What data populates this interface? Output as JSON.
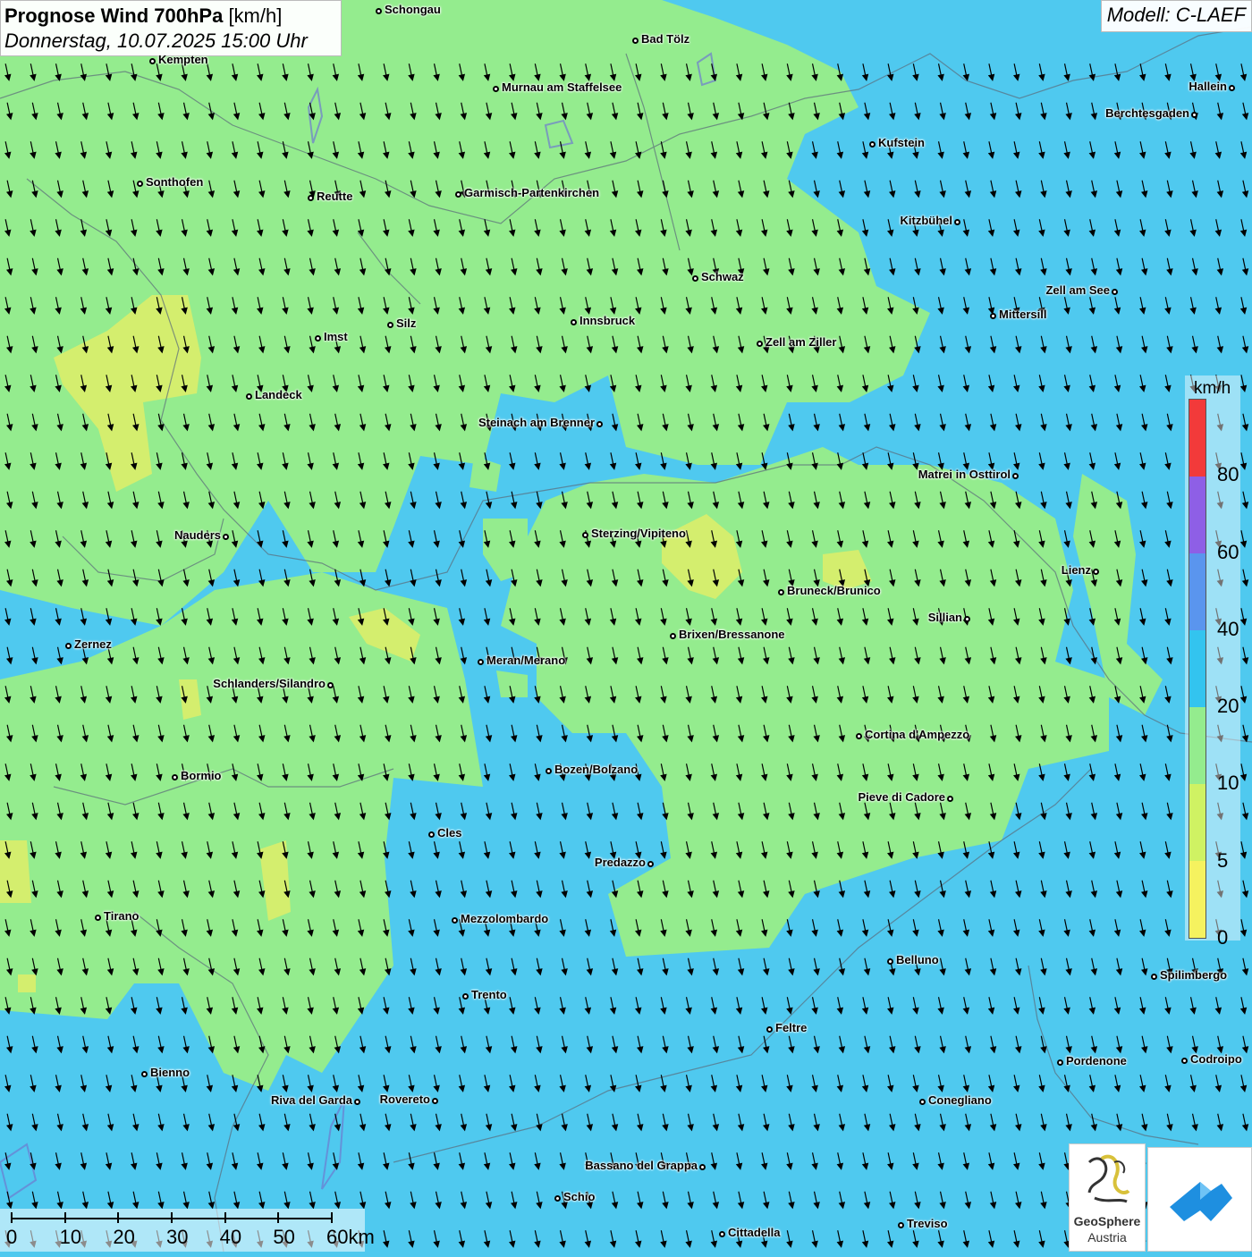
{
  "header": {
    "title_bold": "Prognose Wind 700hPa",
    "title_unit": "[km/h]",
    "datetime": "Donnerstag, 10.07.2025 15:00 Uhr"
  },
  "model_label": "Modell: C-LAEF",
  "legend": {
    "unit": "km/h",
    "ticks": [
      "80",
      "60",
      "40",
      "20",
      "10",
      "5",
      "0"
    ],
    "colors": [
      "#f23a3a",
      "#8e5fe6",
      "#5a95ee",
      "#33c4ef",
      "#94ec8e",
      "#cff263",
      "#f5f25f"
    ]
  },
  "scalebar": {
    "labels": [
      "0",
      "10",
      "20",
      "30",
      "40",
      "50",
      "60km"
    ]
  },
  "logo": {
    "name": "GeoSphere",
    "sub": "Austria"
  },
  "wind_direction": "north-northwest",
  "cities": [
    {
      "name": "Schongau"
    },
    {
      "name": "Bad Tölz"
    },
    {
      "name": "Kempten"
    },
    {
      "name": "Murnau am Staffelsee"
    },
    {
      "name": "Hallein"
    },
    {
      "name": "Berchtesgaden"
    },
    {
      "name": "Kufstein"
    },
    {
      "name": "Sonthofen"
    },
    {
      "name": "Reutte"
    },
    {
      "name": "Garmisch-Partenkirchen"
    },
    {
      "name": "Kitzbühel"
    },
    {
      "name": "Schwaz"
    },
    {
      "name": "Zell am See"
    },
    {
      "name": "Mittersill"
    },
    {
      "name": "Innsbruck"
    },
    {
      "name": "Silz"
    },
    {
      "name": "Imst"
    },
    {
      "name": "Zell am Ziller"
    },
    {
      "name": "Landeck"
    },
    {
      "name": "Steinach am Brenner"
    },
    {
      "name": "Matrei in Osttirol"
    },
    {
      "name": "Nauders"
    },
    {
      "name": "Sterzing/Vipiteno"
    },
    {
      "name": "Lienz"
    },
    {
      "name": "Bruneck/Brunico"
    },
    {
      "name": "Sillian"
    },
    {
      "name": "Brixen/Bressanone"
    },
    {
      "name": "Zernez"
    },
    {
      "name": "Meran/Merano"
    },
    {
      "name": "Schlanders/Silandro"
    },
    {
      "name": "Cortina d'Ampezzo"
    },
    {
      "name": "Bozen/Bolzano"
    },
    {
      "name": "Bormio"
    },
    {
      "name": "Pieve di Cadore"
    },
    {
      "name": "Cles"
    },
    {
      "name": "Predazzo"
    },
    {
      "name": "Tirano"
    },
    {
      "name": "Mezzolombardo"
    },
    {
      "name": "Belluno"
    },
    {
      "name": "Spilimbergo"
    },
    {
      "name": "Trento"
    },
    {
      "name": "Feltre"
    },
    {
      "name": "Pordenone"
    },
    {
      "name": "Codroipo"
    },
    {
      "name": "Bienno"
    },
    {
      "name": "Riva del Garda"
    },
    {
      "name": "Rovereto"
    },
    {
      "name": "Conegliano"
    },
    {
      "name": "Bassano del Grappa"
    },
    {
      "name": "Schio"
    },
    {
      "name": "Treviso"
    },
    {
      "name": "Cittadella"
    }
  ]
}
